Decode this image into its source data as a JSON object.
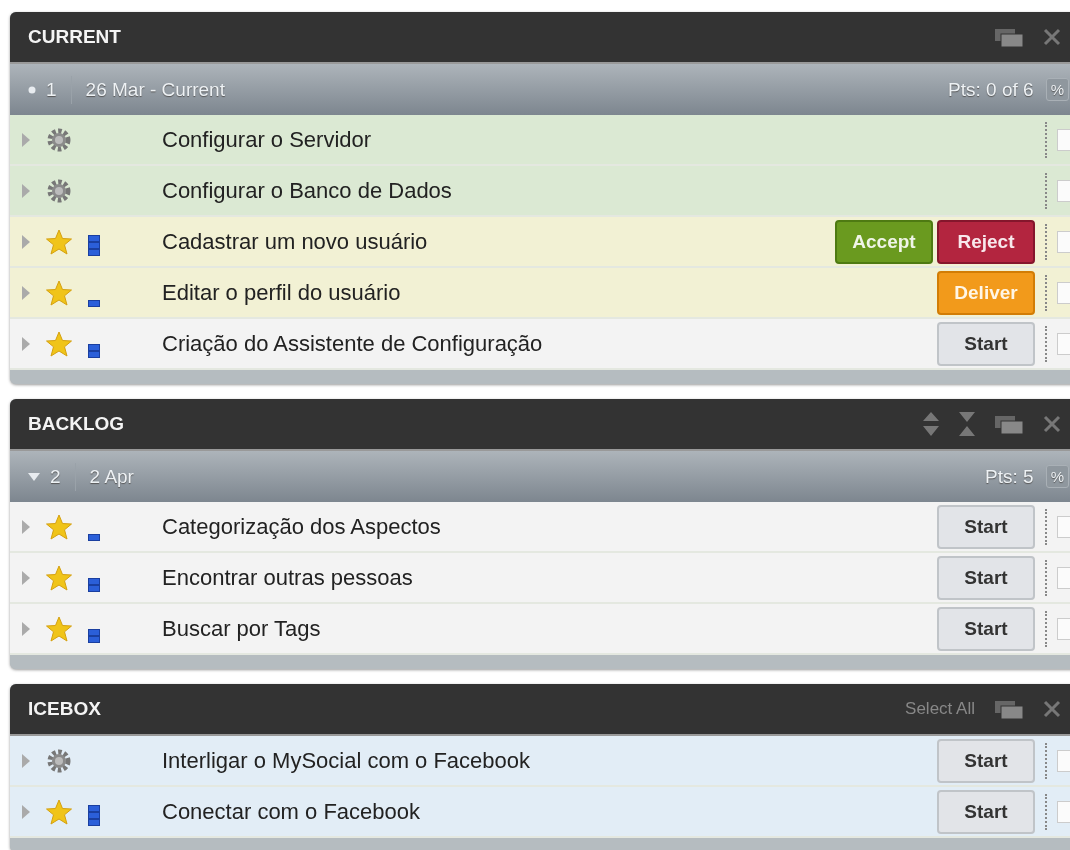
{
  "panels": [
    {
      "title": "CURRENT",
      "tools": [
        {
          "kind": "restore"
        },
        {
          "kind": "close"
        }
      ],
      "iteration": {
        "kind": "dot",
        "number": "1",
        "date": "26 Mar - Current",
        "points": "Pts: 0 of 6",
        "percent": "%"
      },
      "stories": [
        {
          "kind": "chore",
          "color": "#dbe9d3",
          "title": "Configurar o Servidor",
          "checked": false
        },
        {
          "kind": "chore",
          "color": "#dbe9d3",
          "title": "Configurar o Banco de Dados",
          "checked": false
        },
        {
          "kind": "feature",
          "estimate": {
            "kind": "three"
          },
          "color": "#f2f1d4",
          "title": "Cadastrar um novo usuário",
          "buttons": [
            {
              "kind": "accept",
              "label": "Accept"
            },
            {
              "kind": "reject",
              "label": "Reject"
            }
          ],
          "checked": false
        },
        {
          "kind": "feature",
          "estimate": {
            "kind": "one"
          },
          "color": "#f2f1d4",
          "title": "Editar o perfil do usuário",
          "buttons": [
            {
              "kind": "deliver",
              "label": "Deliver"
            }
          ],
          "checked": false
        },
        {
          "kind": "feature",
          "estimate": {
            "kind": "two"
          },
          "color": "#f3f3f3",
          "title": "Criação do Assistente de Configuração",
          "buttons": [
            {
              "kind": "start",
              "label": "Start"
            }
          ],
          "checked": false
        }
      ]
    },
    {
      "title": "BACKLOG",
      "tools": [
        {
          "kind": "sort"
        },
        {
          "kind": "collapse"
        },
        {
          "kind": "restore"
        },
        {
          "kind": "close"
        }
      ],
      "iteration": {
        "kind": "triangle",
        "number": "2",
        "date": "2 Apr",
        "points": "Pts: 5",
        "percent": "%"
      },
      "stories": [
        {
          "kind": "feature",
          "estimate": {
            "kind": "one"
          },
          "color": "#f3f3f3",
          "title": "Categorização dos Aspectos",
          "buttons": [
            {
              "kind": "start",
              "label": "Start"
            }
          ],
          "checked": false
        },
        {
          "kind": "feature",
          "estimate": {
            "kind": "two"
          },
          "color": "#f3f3f3",
          "title": "Encontrar outras pessoas",
          "buttons": [
            {
              "kind": "start",
              "label": "Start"
            }
          ],
          "checked": false
        },
        {
          "kind": "feature",
          "estimate": {
            "kind": "two"
          },
          "color": "#f3f3f3",
          "title": "Buscar por Tags",
          "buttons": [
            {
              "kind": "start",
              "label": "Start"
            }
          ],
          "checked": false
        }
      ]
    },
    {
      "title": "ICEBOX",
      "tools": [
        {
          "kind": "link",
          "label": "Select All"
        },
        {
          "kind": "restore"
        },
        {
          "kind": "close"
        }
      ],
      "stories": [
        {
          "kind": "chore",
          "color": "#e2edf6",
          "title": "Interligar o MySocial com o Facebook",
          "buttons": [
            {
              "kind": "start",
              "label": "Start"
            }
          ],
          "checked": false
        },
        {
          "kind": "feature",
          "estimate": {
            "kind": "three"
          },
          "color": "#e2edf6",
          "title": "Conectar com o Facebook",
          "buttons": [
            {
              "kind": "start",
              "label": "Start"
            }
          ],
          "checked": false
        }
      ]
    }
  ]
}
